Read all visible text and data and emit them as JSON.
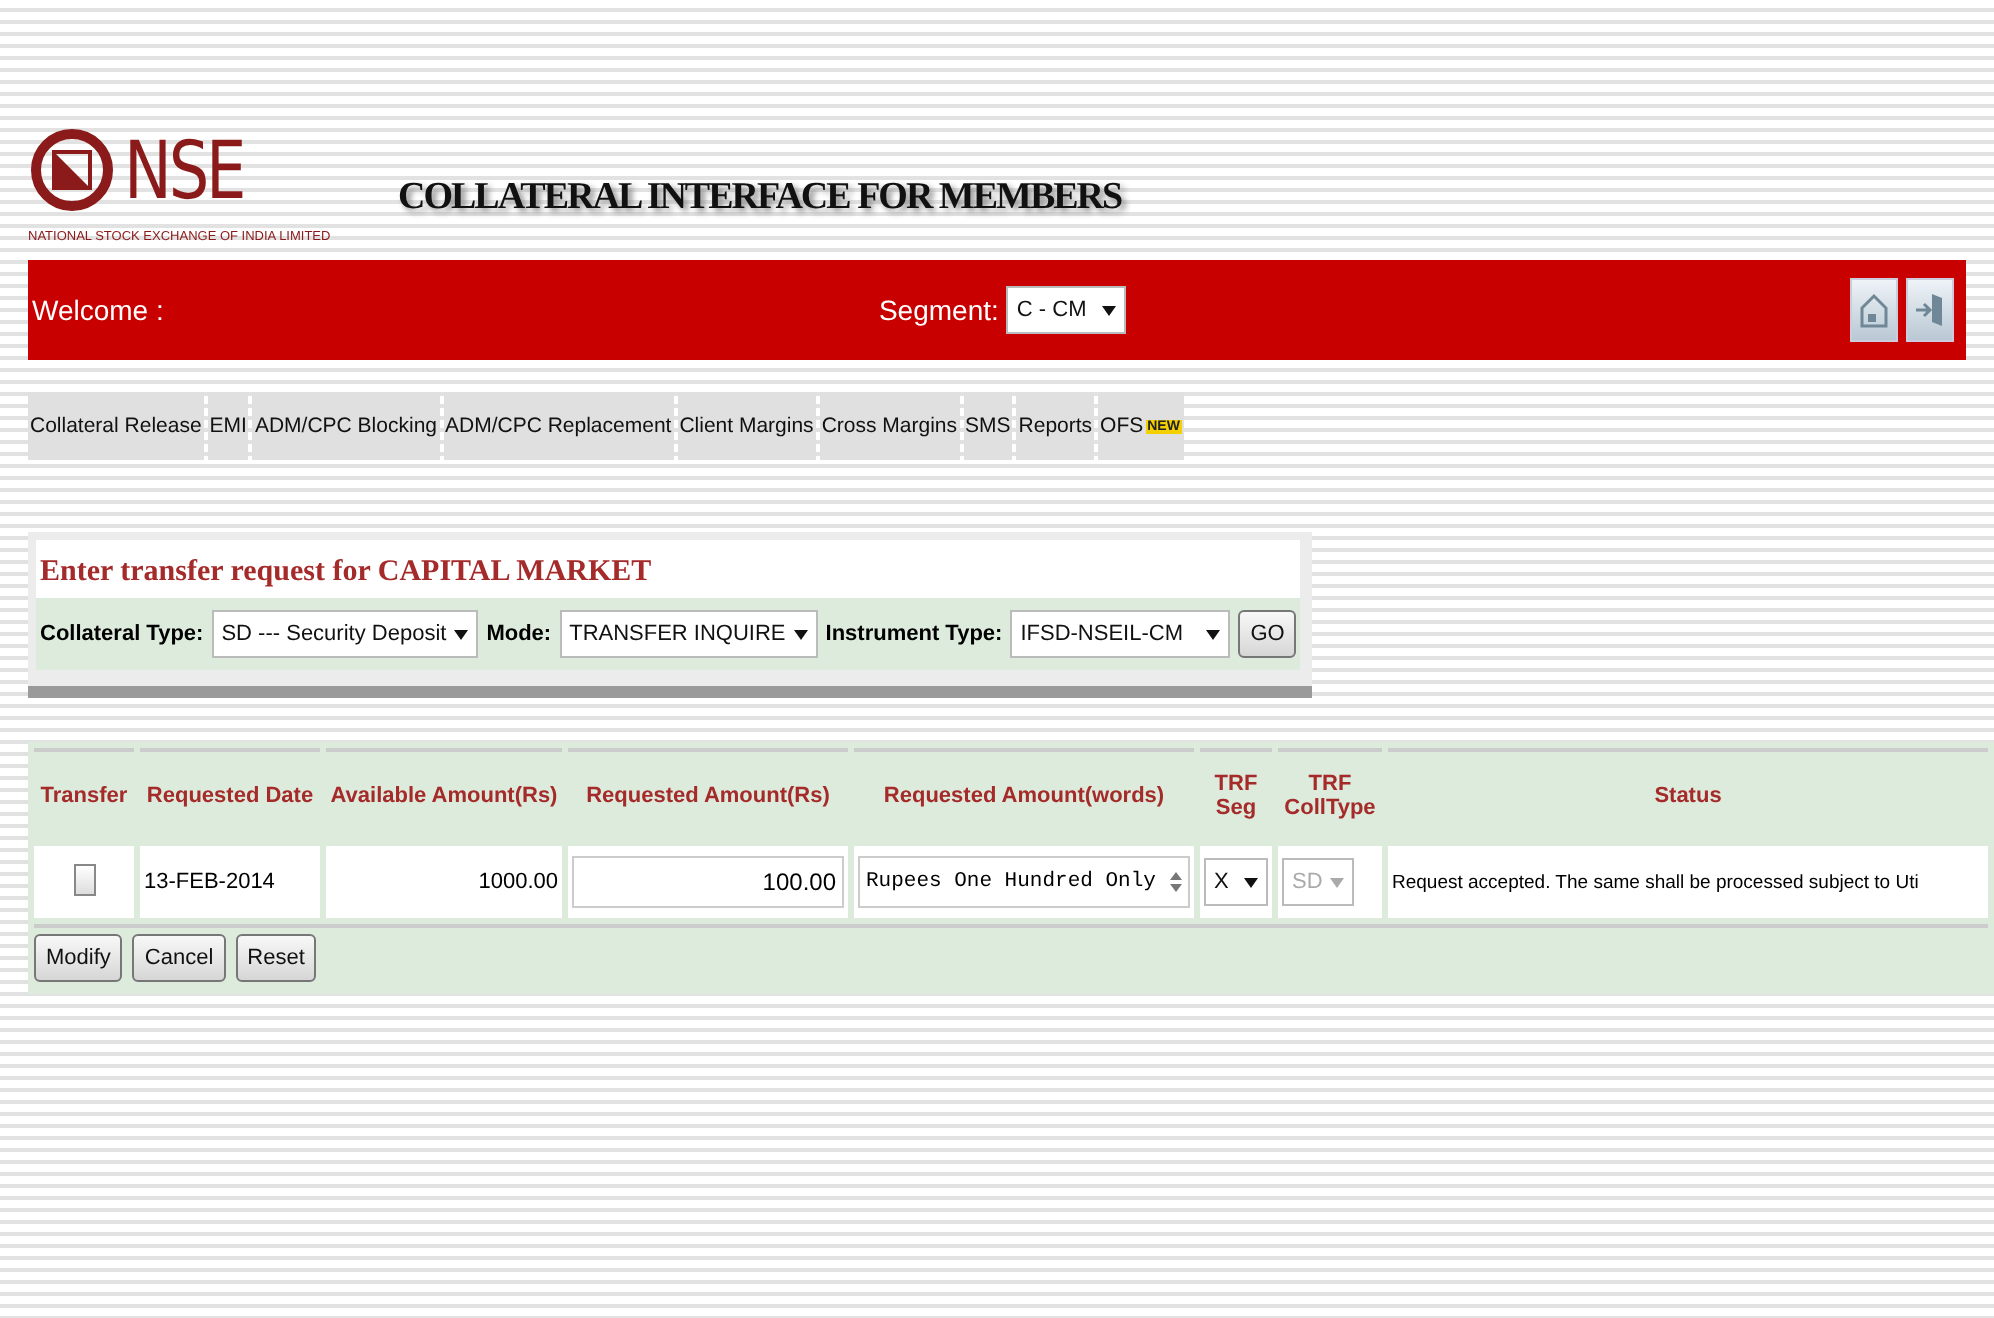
{
  "header": {
    "logo_text": "NSE",
    "logo_subtitle": "NATIONAL STOCK EXCHANGE OF INDIA LIMITED",
    "title": "COLLATERAL INTERFACE FOR MEMBERS"
  },
  "top_bar": {
    "welcome": "Welcome :",
    "segment_label": "Segment:",
    "segment_value": "C - CM"
  },
  "menu": [
    {
      "label": "Collateral Release"
    },
    {
      "label": "EMI"
    },
    {
      "label": "ADM/CPC Blocking"
    },
    {
      "label": "ADM/CPC Replacement"
    },
    {
      "label": "Client Margins"
    },
    {
      "label": "Cross Margins"
    },
    {
      "label": "SMS"
    },
    {
      "label": "Reports"
    },
    {
      "label": "OFS",
      "badge": "NEW"
    }
  ],
  "form": {
    "title": "Enter transfer request for CAPITAL MARKET",
    "fields": [
      {
        "label": "Collateral Type:",
        "value": "SD --- Security Deposit"
      },
      {
        "label": "Mode:",
        "value": "TRANSFER INQUIRE"
      },
      {
        "label": "Instrument Type:",
        "value": "IFSD-NSEIL-CM"
      }
    ],
    "go_button": "GO"
  },
  "table": {
    "columns": [
      "Transfer",
      "Requested Date",
      "Available Amount(Rs)",
      "Requested Amount(Rs)",
      "Requested Amount(words)",
      "TRF Seg",
      "TRF CollType",
      "Status"
    ],
    "rows": [
      {
        "checked": false,
        "date": "13-FEB-2014",
        "available": "1000.00",
        "requested": "100.00",
        "words": "Rupees One Hundred Only",
        "seg": "X",
        "colltype": "SD",
        "colltype_disabled": true,
        "status": "Request accepted. The same shall be processed subject to Uti"
      }
    ],
    "buttons": [
      "Modify",
      "Cancel",
      "Reset"
    ]
  }
}
